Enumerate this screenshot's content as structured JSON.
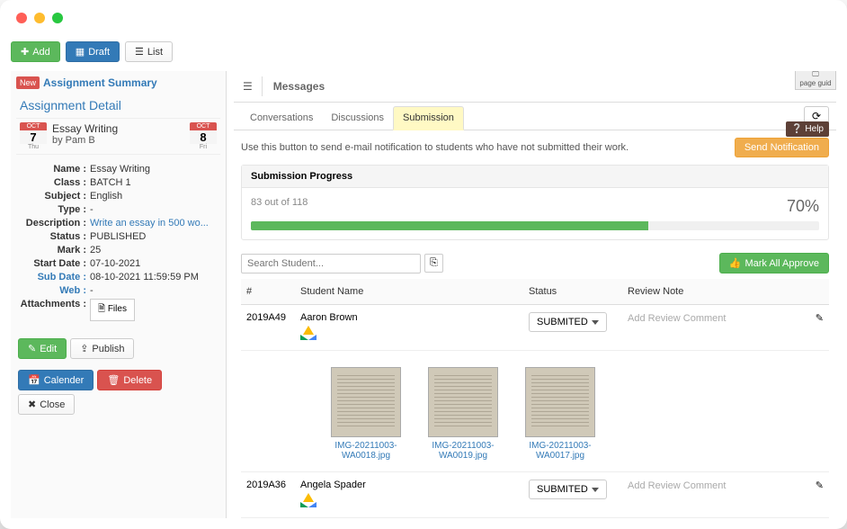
{
  "toolbar": {
    "add": "Add",
    "draft": "Draft",
    "list": "List"
  },
  "sidebar": {
    "new_badge": "New",
    "summary_title": "Assignment Summary",
    "detail_title": "Assignment Detail",
    "start_date": {
      "month": "OCT",
      "day": "7",
      "weekday": "Thu"
    },
    "end_date": {
      "month": "OCT",
      "day": "8",
      "weekday": "Fri"
    },
    "assignment": {
      "title": "Essay Writing",
      "author": "by Pam B"
    },
    "fields": {
      "name": {
        "label": "Name :",
        "value": "Essay Writing"
      },
      "class": {
        "label": "Class :",
        "value": "BATCH 1"
      },
      "subject": {
        "label": "Subject :",
        "value": "English"
      },
      "type": {
        "label": "Type :",
        "value": "-"
      },
      "description": {
        "label": "Description :",
        "value": "Write an essay in 500 wo..."
      },
      "status": {
        "label": "Status :",
        "value": "PUBLISHED"
      },
      "mark": {
        "label": "Mark :",
        "value": "25"
      },
      "start_date_f": {
        "label": "Start Date :",
        "value": "07-10-2021"
      },
      "sub_date": {
        "label": "Sub Date :",
        "value": "08-10-2021 11:59:59 PM"
      },
      "web": {
        "label": "Web :",
        "value": "-"
      },
      "attachments": {
        "label": "Attachments :",
        "files_btn": "Files"
      }
    },
    "actions": {
      "edit": "Edit",
      "publish": "Publish",
      "calender": "Calender",
      "delete": "Delete",
      "close": "Close"
    }
  },
  "messages": {
    "header": "Messages",
    "page_guide": "page guid",
    "tabs": {
      "conversations": "Conversations",
      "discussions": "Discussions",
      "submission": "Submission"
    },
    "notification_hint": "Use this button to send e-mail notification to students who have not submitted their work.",
    "send_notification": "Send Notification",
    "help": "Help",
    "progress": {
      "title": "Submission Progress",
      "text": "83 out of 118",
      "percent_label": "70%",
      "percent": 70
    },
    "search_placeholder": "Search Student...",
    "mark_all": "Mark All Approve",
    "columns": {
      "id": "#",
      "name": "Student Name",
      "status": "Status",
      "review": "Review Note"
    },
    "rows": [
      {
        "id": "2019A49",
        "name": "Aaron Brown",
        "status": "SUBMITED",
        "review_placeholder": "Add Review Comment",
        "thumbs": [
          {
            "filename": "IMG-20211003-WA0018.jpg"
          },
          {
            "filename": "IMG-20211003-WA0019.jpg"
          },
          {
            "filename": "IMG-20211003-WA0017.jpg"
          }
        ]
      },
      {
        "id": "2019A36",
        "name": "Angela Spader",
        "status": "SUBMITED",
        "review_placeholder": "Add Review Comment",
        "thumbs": []
      }
    ]
  }
}
